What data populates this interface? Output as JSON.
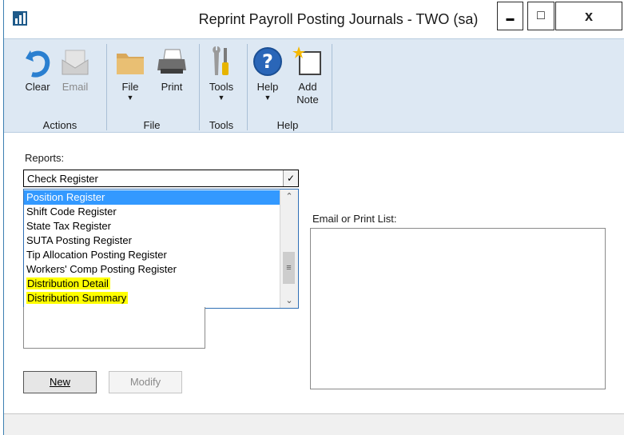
{
  "window": {
    "title": "Reprint Payroll Posting Journals  -  TWO (sa)",
    "minimize_glyph": "▬",
    "maximize_glyph": "□",
    "close_glyph": "x"
  },
  "ribbon": {
    "buttons": {
      "clear": "Clear",
      "email": "Email",
      "file": "File",
      "print": "Print",
      "tools": "Tools",
      "help": "Help",
      "add_note_line1": "Add",
      "add_note_line2": "Note"
    },
    "groups": {
      "actions": "Actions",
      "file": "File",
      "tools": "Tools",
      "help": "Help"
    },
    "dropdown_arrow": "▼"
  },
  "reports": {
    "label": "Reports:",
    "selected": "Check Register",
    "options": [
      "Position Register",
      "Shift Code Register",
      "State Tax Register",
      "SUTA Posting Register",
      "Tip Allocation Posting Register",
      "Workers' Comp Posting Register",
      "Distribution Detail",
      "Distribution Summary"
    ],
    "highlighted_option": "Position Register"
  },
  "email_print": {
    "label": "Email or Print List:"
  },
  "buttons": {
    "new": "New",
    "modify": "Modify"
  },
  "colors": {
    "ribbon_bg": "#dde8f3",
    "selection": "#3399ff",
    "highlight": "#ffff00"
  }
}
